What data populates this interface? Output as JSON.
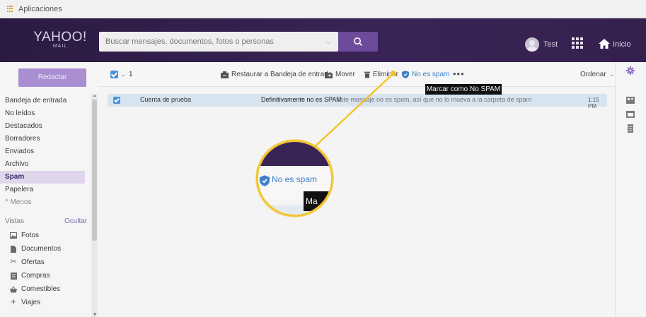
{
  "apps_bar": {
    "label": "Aplicaciones"
  },
  "header": {
    "logo_main": "YAHOO!",
    "logo_sub": "MAIL",
    "search_placeholder": "Buscar mensajes, documentos, fotos o personas",
    "user_name": "Test",
    "home_label": "Inicio"
  },
  "sidebar": {
    "compose_label": "Redactar",
    "folders": [
      "Bandeja de entrada",
      "No leídos",
      "Destacados",
      "Borradores",
      "Enviados",
      "Archivo",
      "Spam",
      "Papelera"
    ],
    "active_folder": "Spam",
    "less_label": "^ Menos",
    "views_label": "Vistas",
    "hide_label": "Ocultar",
    "views": [
      "Fotos",
      "Documentos",
      "Ofertas",
      "Compras",
      "Comestibles",
      "Viajes"
    ]
  },
  "toolbar": {
    "selected_count": "1",
    "restore_label": "Restaurar a Bandeja de entrada",
    "move_label": "Mover",
    "delete_label": "Eliminar",
    "not_spam_label": "No es spam",
    "more_label": "•••",
    "sort_label": "Ordenar"
  },
  "messages": [
    {
      "from": "Cuenta de prueba",
      "subject": "Definitivamente no es SPAM",
      "snippet": "Este mensaje no es spam, así que no lo mueva a la carpeta de spam",
      "time": "1:15 PM",
      "selected": true
    }
  ],
  "tooltip": {
    "text": "Marcar como No SPAM"
  },
  "callout": {
    "zoom_text": "No es spam",
    "zoom_tooltip_text": "Ma"
  },
  "colors": {
    "header_bg": "#35204e",
    "accent_purple": "#6d4a9a",
    "compose_bg": "#a98ed1",
    "selected_row": "#d6e4f0",
    "link_blue": "#3f80c9",
    "callout_yellow": "#f2c42c"
  }
}
